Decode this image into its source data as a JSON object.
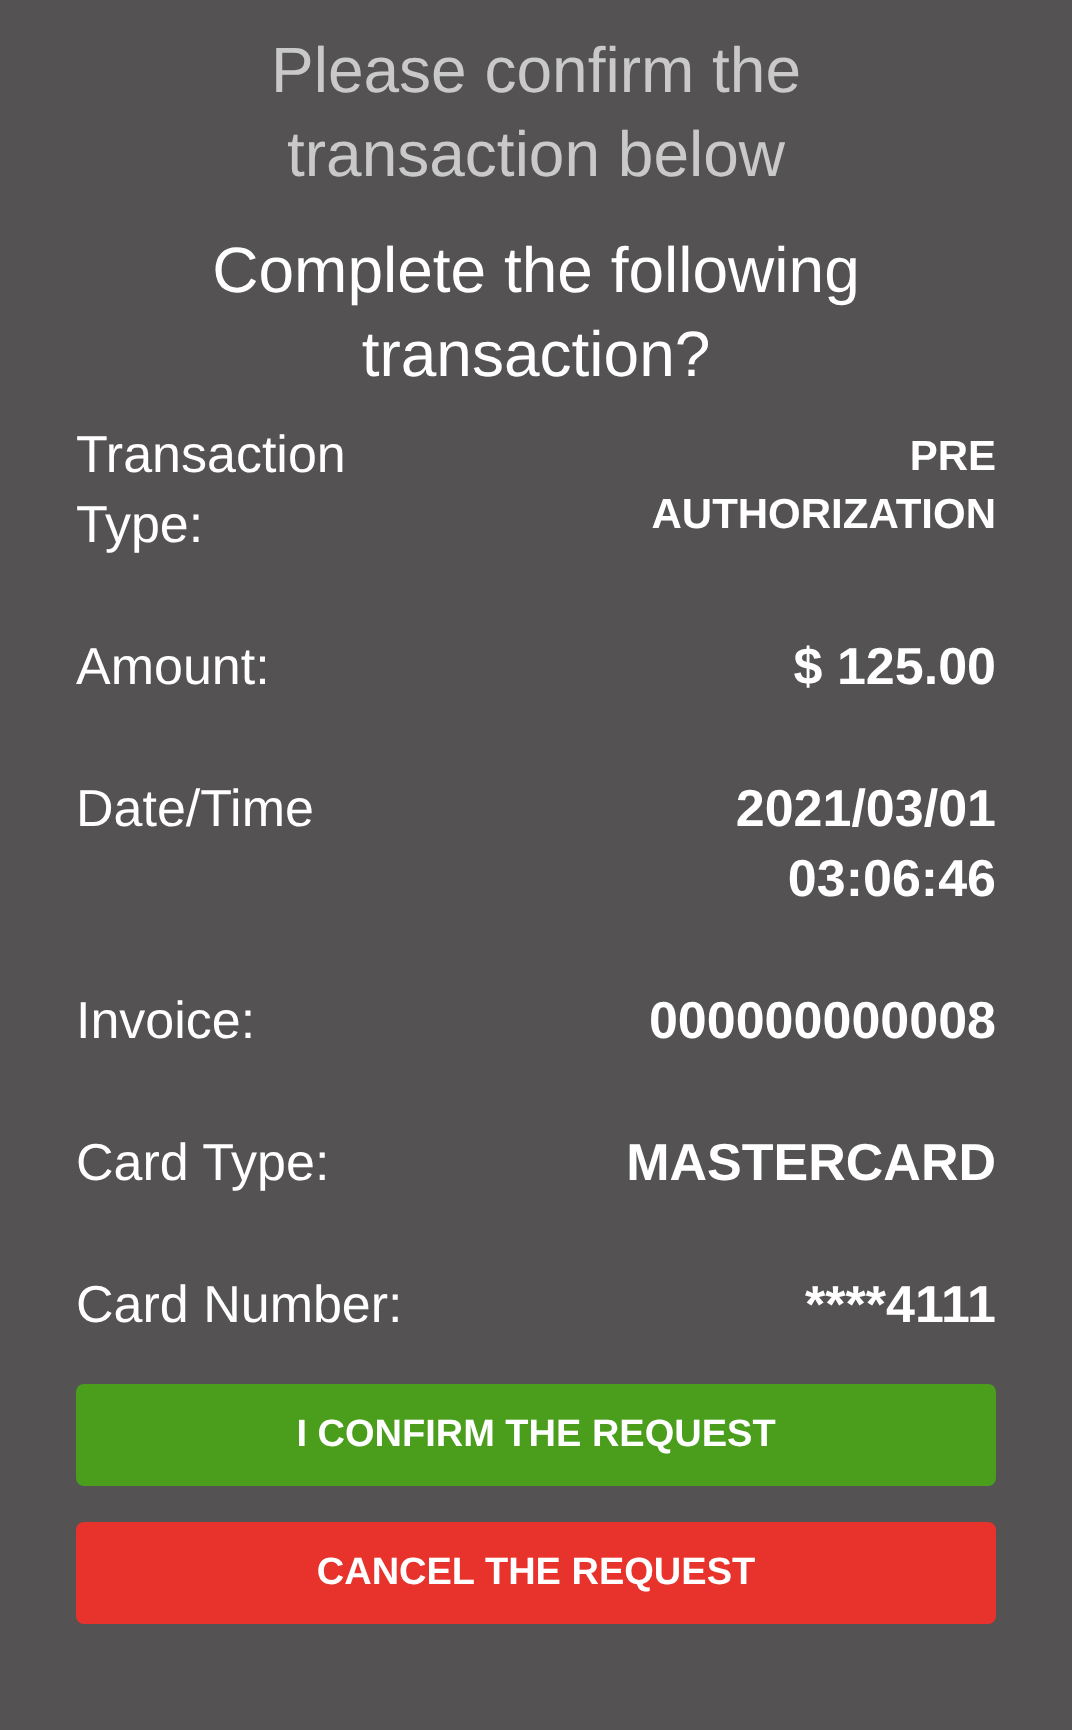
{
  "header": "Please confirm the transaction below",
  "question": "Complete the following transaction?",
  "details": [
    {
      "label": "Transaction Type:",
      "value": "PRE AUTHORIZATION",
      "kind": "small"
    },
    {
      "label": "Amount:",
      "value": "$ 125.00",
      "kind": "large"
    },
    {
      "label": "Date/Time",
      "value": "2021/03/01 03:06:46",
      "kind": "large"
    },
    {
      "label": "Invoice:",
      "value": "000000000008",
      "kind": "large"
    },
    {
      "label": "Card Type:",
      "value": "MASTERCARD",
      "kind": "large"
    },
    {
      "label": "Card Number:",
      "value": "****4111",
      "kind": "large"
    }
  ],
  "buttons": [
    {
      "label": "I CONFIRM THE REQUEST",
      "kind": "confirm"
    },
    {
      "label": "CANCEL THE REQUEST",
      "kind": "cancel"
    }
  ]
}
